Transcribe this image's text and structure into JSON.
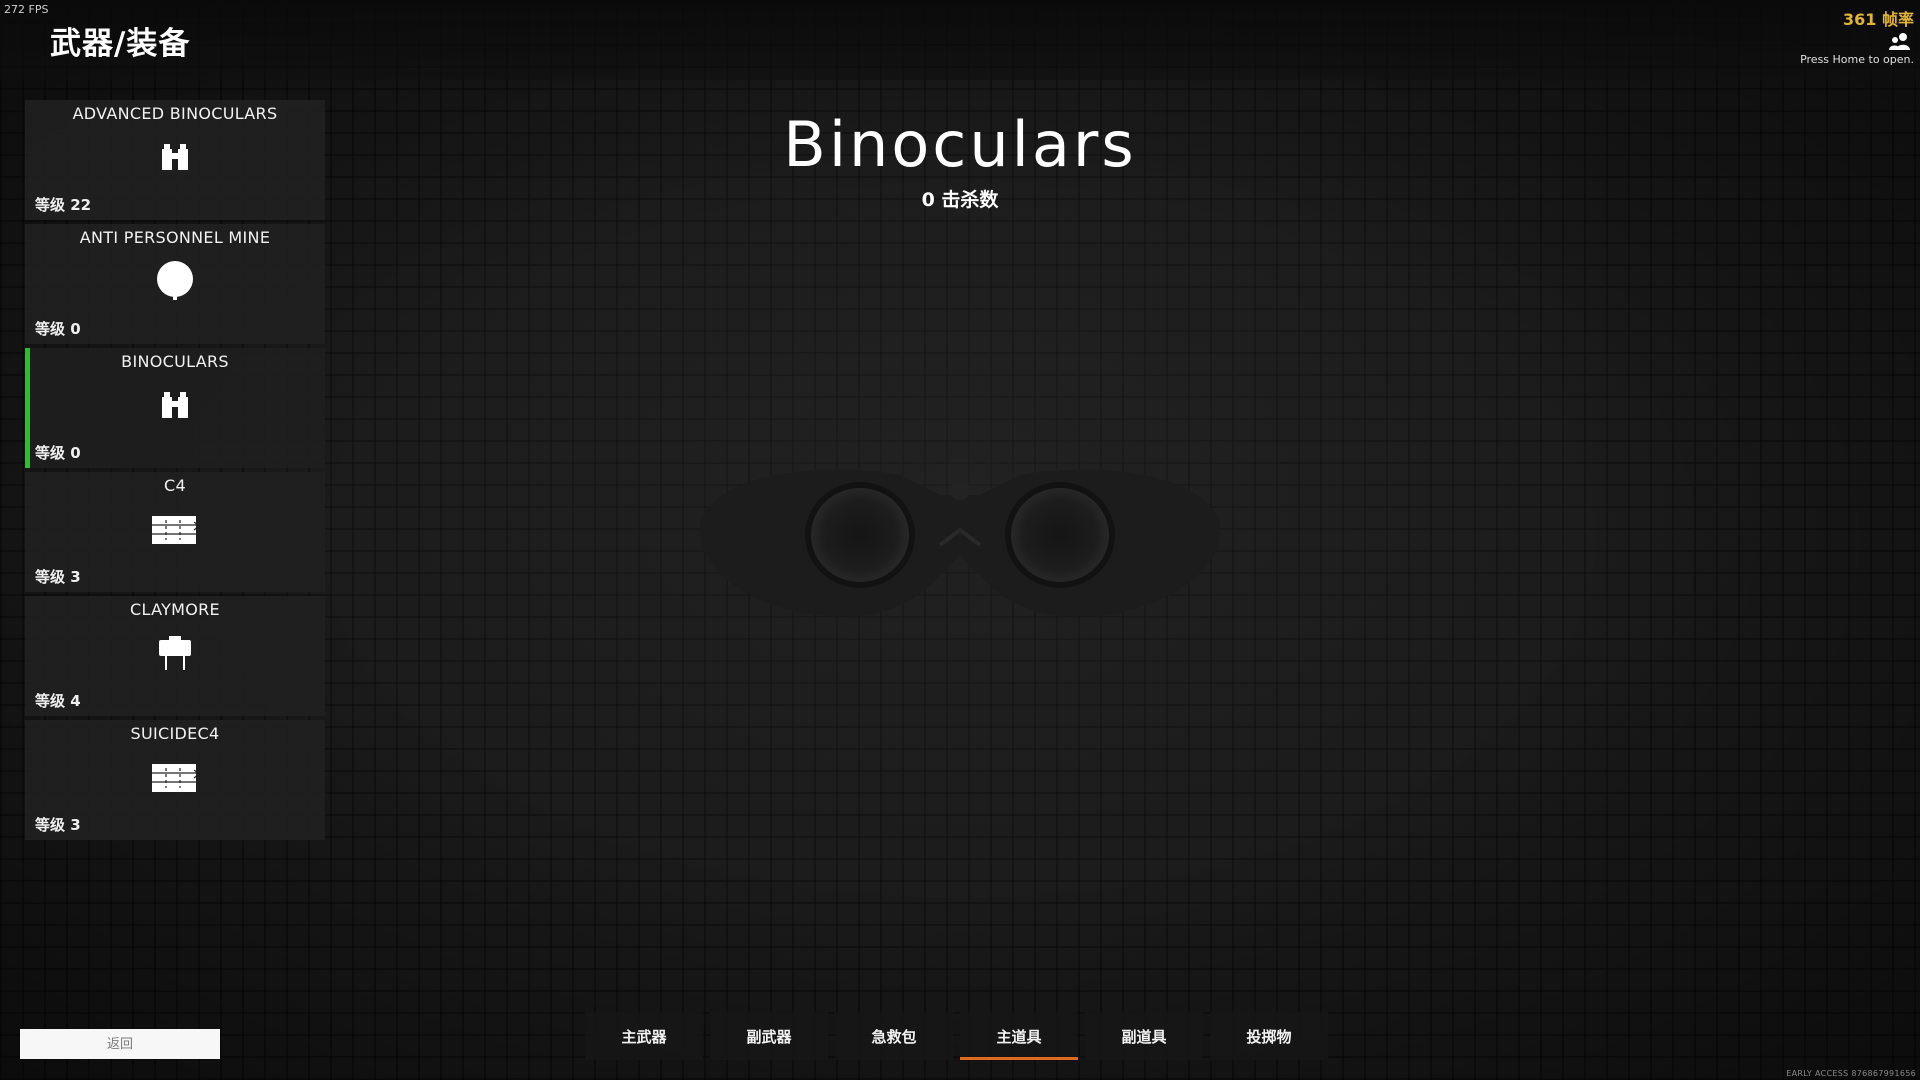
{
  "overlay": {
    "fps_small": "272 FPS",
    "fps_right": "361 帧率",
    "press_home": "Press Home to open.",
    "friends_icon": "friends-icon",
    "early_access": "EARLY ACCESS 876867991656"
  },
  "header": {
    "title": "武器/装备"
  },
  "items": [
    {
      "name": "ADVANCED BINOCULARS",
      "level": "等级 22",
      "icon": "binoculars-icon",
      "selected": false
    },
    {
      "name": "ANTI PERSONNEL MINE",
      "level": "等级 0",
      "icon": "mine-icon",
      "selected": false
    },
    {
      "name": "BINOCULARS",
      "level": "等级 0",
      "icon": "binoculars-icon",
      "selected": true
    },
    {
      "name": "C4",
      "level": "等级 3",
      "icon": "c4-icon",
      "selected": false
    },
    {
      "name": "CLAYMORE",
      "level": "等级 4",
      "icon": "claymore-icon",
      "selected": false
    },
    {
      "name": "SUICIDEC4",
      "level": "等级 3",
      "icon": "c4-icon",
      "selected": false
    }
  ],
  "detail": {
    "title": "Binoculars",
    "kills": "0 击杀数"
  },
  "back_button": "返回",
  "tabs": [
    {
      "label": "主武器",
      "active": false
    },
    {
      "label": "副武器",
      "active": false
    },
    {
      "label": "急救包",
      "active": false
    },
    {
      "label": "主道具",
      "active": true
    },
    {
      "label": "副道具",
      "active": false
    },
    {
      "label": "投掷物",
      "active": false
    }
  ],
  "colors": {
    "selected_accent": "#25c325",
    "active_tab_accent": "#e06a1f",
    "fps_color": "#e2b531"
  }
}
